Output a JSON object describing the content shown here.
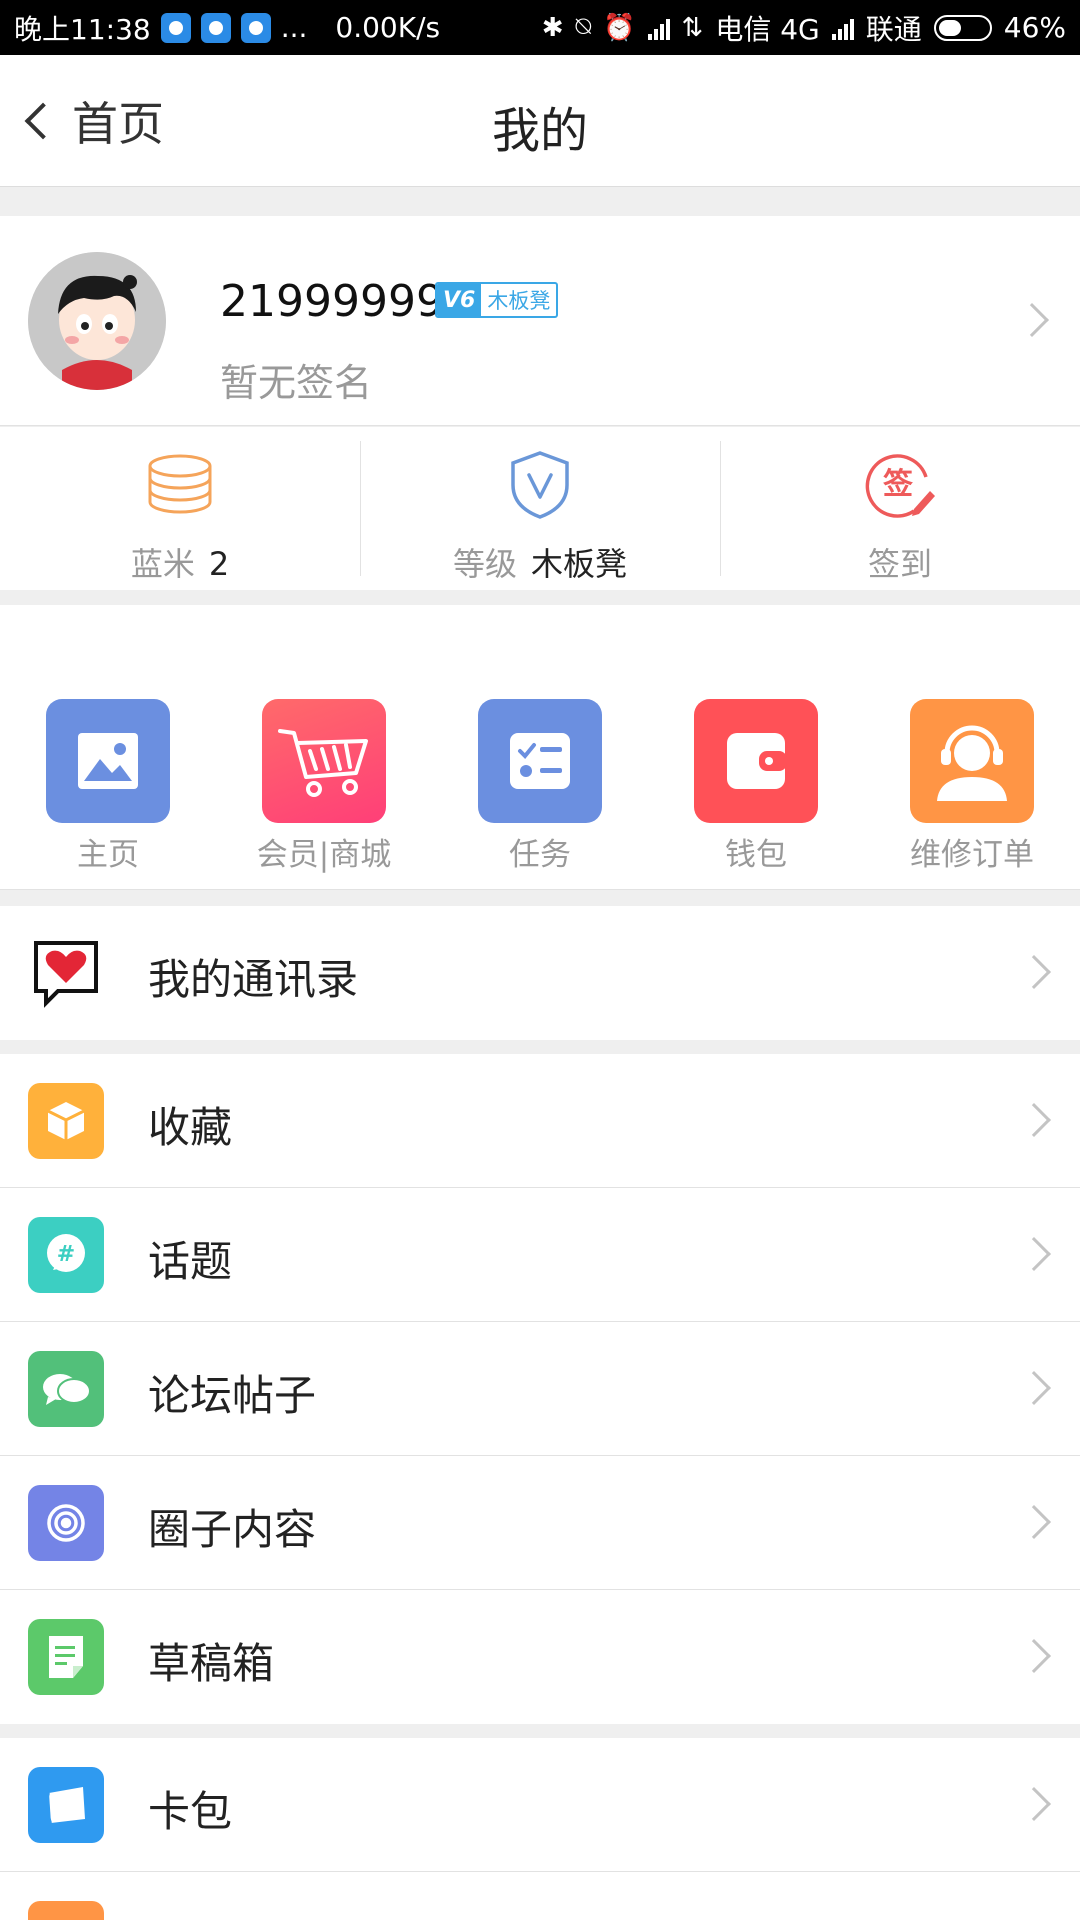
{
  "status_bar": {
    "time": "晚上11:38",
    "more": "...",
    "speed": "0.00K/s",
    "carrier1": "电信 4G",
    "carrier2": "联通",
    "battery": "46%",
    "battery_level": 0.46
  },
  "nav": {
    "back_label": "首页",
    "title": "我的"
  },
  "profile": {
    "username": "21999999",
    "badge_v": "V6",
    "badge_level": "木板凳",
    "signature": "暂无签名"
  },
  "stats": [
    {
      "label": "蓝米",
      "value": "2",
      "icon": "coins-icon",
      "color": "#f5a45a"
    },
    {
      "label": "等级",
      "value": "木板凳",
      "icon": "shield-v-icon",
      "color": "#6a97d8"
    },
    {
      "label": "签到",
      "value": "",
      "icon": "sign-in-icon",
      "color": "#ee5a5a",
      "glyph": "签"
    }
  ],
  "shortcuts": [
    {
      "label": "主页",
      "icon": "image-icon",
      "color": "#6b8fe0"
    },
    {
      "label": "会员|商城",
      "icon": "cart-icon",
      "color": "#ff5167"
    },
    {
      "label": "任务",
      "icon": "task-list-icon",
      "color": "#6b8fe0"
    },
    {
      "label": "钱包",
      "icon": "wallet-icon",
      "color": "#ff5157"
    },
    {
      "label": "维修订单",
      "icon": "support-agent-icon",
      "color": "#ff9545"
    }
  ],
  "contacts": {
    "label": "我的通讯录",
    "icon": "heart-chat-icon"
  },
  "menu": [
    {
      "label": "收藏",
      "icon": "cube-icon",
      "color": "#ffb13b"
    },
    {
      "label": "话题",
      "icon": "hashtag-icon",
      "color": "#3ccfc2",
      "glyph": "#"
    },
    {
      "label": "论坛帖子",
      "icon": "chat-bubbles-icon",
      "color": "#52c07a"
    },
    {
      "label": "圈子内容",
      "icon": "circle-icon",
      "color": "#7484e6"
    },
    {
      "label": "草稿箱",
      "icon": "draft-icon",
      "color": "#5cc96a"
    }
  ],
  "menu2": [
    {
      "label": "卡包",
      "icon": "card-icon",
      "color": "#2f9af0"
    }
  ],
  "colors": {
    "accent": "#3aa7e6",
    "background": "#efefef"
  }
}
